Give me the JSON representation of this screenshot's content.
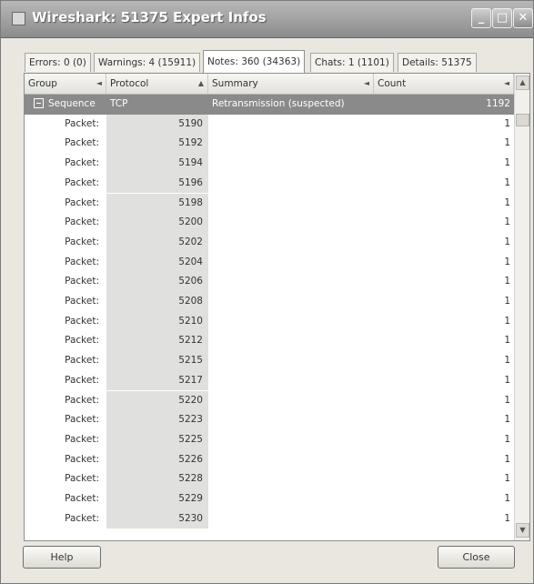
{
  "window": {
    "title": "Wireshark: 51375 Expert Infos",
    "controls": {
      "minimize_icon": "_",
      "maximize_icon": "□",
      "close_icon": "✕"
    }
  },
  "tabs": [
    {
      "label": "Errors: 0 (0)"
    },
    {
      "label": "Warnings: 4 (15911)"
    },
    {
      "label": "Notes: 360 (34363)",
      "active": true
    },
    {
      "label": "Chats: 1 (1101)"
    },
    {
      "label": "Details: 51375"
    }
  ],
  "columns": {
    "group": "Group",
    "protocol": "Protocol",
    "summary": "Summary",
    "count": "Count"
  },
  "header_arrows": {
    "group": "◄",
    "protocol": "▲",
    "summary": "◄",
    "count": "◄"
  },
  "sequence_row": {
    "group": "Sequence",
    "protocol": "TCP",
    "summary": "Retransmission (suspected)",
    "count": "1192"
  },
  "packet_label": "Packet:",
  "packets": [
    {
      "packet": "5190",
      "count": "1"
    },
    {
      "packet": "5192",
      "count": "1"
    },
    {
      "packet": "5194",
      "count": "1"
    },
    {
      "packet": "5196",
      "count": "1"
    },
    {
      "packet": "5198",
      "count": "1"
    },
    {
      "packet": "5200",
      "count": "1"
    },
    {
      "packet": "5202",
      "count": "1"
    },
    {
      "packet": "5204",
      "count": "1"
    },
    {
      "packet": "5206",
      "count": "1"
    },
    {
      "packet": "5208",
      "count": "1"
    },
    {
      "packet": "5210",
      "count": "1"
    },
    {
      "packet": "5212",
      "count": "1"
    },
    {
      "packet": "5215",
      "count": "1"
    },
    {
      "packet": "5217",
      "count": "1"
    },
    {
      "packet": "5220",
      "count": "1"
    },
    {
      "packet": "5223",
      "count": "1"
    },
    {
      "packet": "5225",
      "count": "1"
    },
    {
      "packet": "5226",
      "count": "1"
    },
    {
      "packet": "5228",
      "count": "1"
    },
    {
      "packet": "5229",
      "count": "1"
    },
    {
      "packet": "5230",
      "count": "1"
    }
  ],
  "scrollbar": {
    "up_icon": "▲",
    "down_icon": "▼"
  },
  "buttons": {
    "help": "Help",
    "close": "Close"
  }
}
